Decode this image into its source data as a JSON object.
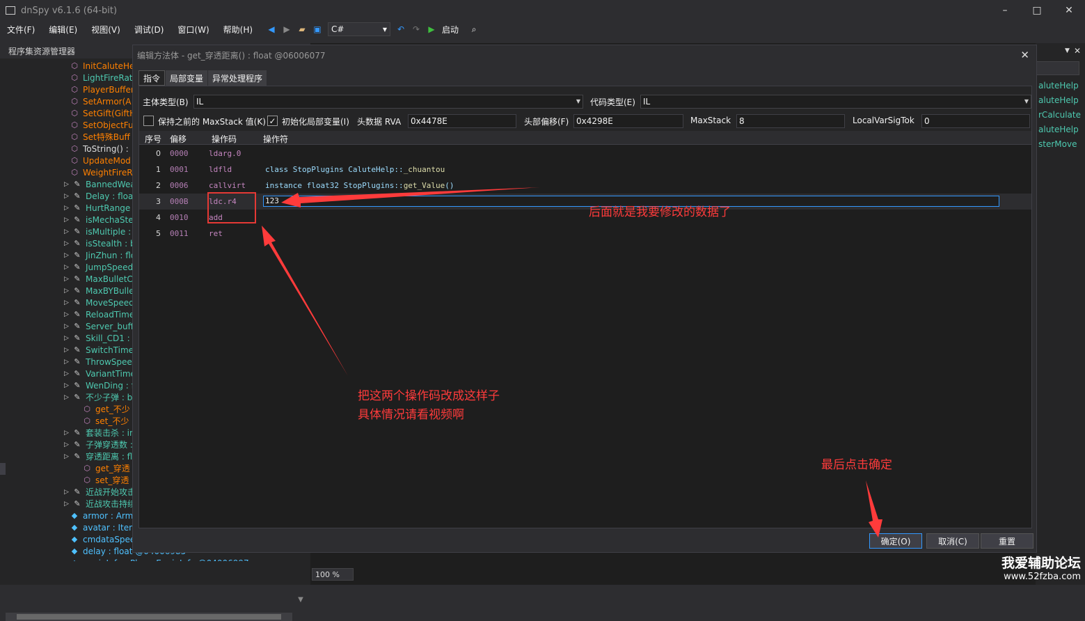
{
  "window": {
    "title": "dnSpy v6.1.6 (64-bit)",
    "minimize": "–",
    "maximize": "□",
    "close": "✕"
  },
  "menu": [
    "文件(F)",
    "编辑(E)",
    "视图(V)",
    "调试(D)",
    "窗口(W)",
    "帮助(H)"
  ],
  "toolbar": {
    "language": "C#",
    "run_label": "启动"
  },
  "left_panel": {
    "title": "程序集资源管理器",
    "items": [
      {
        "text": "InitCaluteHe",
        "color": "orange",
        "icon": "method-icon",
        "expand": false,
        "indent": 0
      },
      {
        "text": "LightFireRat",
        "color": "teal",
        "icon": "method-icon",
        "expand": false,
        "indent": 0
      },
      {
        "text": "PlayerBuffer",
        "color": "orange",
        "icon": "method-icon",
        "expand": false,
        "indent": 0
      },
      {
        "text": "SetArmor(A",
        "color": "orange",
        "icon": "method-icon",
        "expand": false,
        "indent": 0
      },
      {
        "text": "SetGift(GiftH",
        "color": "orange",
        "icon": "method-icon",
        "expand": false,
        "indent": 0
      },
      {
        "text": "SetObjectFu",
        "color": "orange",
        "icon": "method-icon",
        "expand": false,
        "indent": 0
      },
      {
        "text": "Set特殊Buff",
        "color": "orange",
        "icon": "method-icon",
        "expand": false,
        "indent": 0
      },
      {
        "text": "ToString() :",
        "color": "white",
        "icon": "method-icon",
        "expand": false,
        "indent": 0
      },
      {
        "text": "UpdateMod",
        "color": "orange",
        "icon": "method-icon",
        "expand": false,
        "indent": 0
      },
      {
        "text": "WeightFireR",
        "color": "orange",
        "icon": "method-icon",
        "expand": false,
        "indent": 0
      },
      {
        "text": "BannedWea",
        "color": "teal",
        "icon": "wrench-icon",
        "expand": true,
        "indent": -1
      },
      {
        "text": "Delay : float",
        "color": "teal",
        "icon": "wrench-icon",
        "expand": true,
        "indent": -1
      },
      {
        "text": "HurtRange",
        "color": "teal",
        "icon": "wrench-icon",
        "expand": true,
        "indent": -1
      },
      {
        "text": "isMechaSte",
        "color": "teal",
        "icon": "wrench-icon",
        "expand": true,
        "indent": -1
      },
      {
        "text": "isMultiple :",
        "color": "teal",
        "icon": "wrench-icon",
        "expand": true,
        "indent": -1
      },
      {
        "text": "isStealth : b",
        "color": "teal",
        "icon": "wrench-icon",
        "expand": true,
        "indent": -1
      },
      {
        "text": "JinZhun : flo",
        "color": "teal",
        "icon": "wrench-icon",
        "expand": true,
        "indent": -1
      },
      {
        "text": "JumpSpeed",
        "color": "teal",
        "icon": "wrench-icon",
        "expand": true,
        "indent": -1
      },
      {
        "text": "MaxBulletCl",
        "color": "teal",
        "icon": "wrench-icon",
        "expand": true,
        "indent": -1
      },
      {
        "text": "MaxBYBulle",
        "color": "teal",
        "icon": "wrench-icon",
        "expand": true,
        "indent": -1
      },
      {
        "text": "MoveSpeed",
        "color": "teal",
        "icon": "wrench-icon",
        "expand": true,
        "indent": -1
      },
      {
        "text": "ReloadTime",
        "color": "teal",
        "icon": "wrench-icon",
        "expand": true,
        "indent": -1
      },
      {
        "text": "Server_buff",
        "color": "teal",
        "icon": "wrench-icon",
        "expand": true,
        "indent": -1
      },
      {
        "text": "Skill_CD1 : f",
        "color": "teal",
        "icon": "wrench-icon",
        "expand": true,
        "indent": -1
      },
      {
        "text": "SwitchTime",
        "color": "teal",
        "icon": "wrench-icon",
        "expand": true,
        "indent": -1
      },
      {
        "text": "ThrowSpeed",
        "color": "teal",
        "icon": "wrench-icon",
        "expand": true,
        "indent": -1
      },
      {
        "text": "VariantTime",
        "color": "teal",
        "icon": "wrench-icon",
        "expand": true,
        "indent": -1
      },
      {
        "text": "WenDing : f",
        "color": "teal",
        "icon": "wrench-icon",
        "expand": true,
        "indent": -1
      },
      {
        "text": "不少子弹 : b",
        "color": "teal",
        "icon": "wrench-icon",
        "expand": true,
        "indent": -1
      },
      {
        "text": "get_不少",
        "color": "orange",
        "icon": "method-icon",
        "expand": false,
        "indent": 1
      },
      {
        "text": "set_不少",
        "color": "orange",
        "icon": "method-icon",
        "expand": false,
        "indent": 1
      },
      {
        "text": "套装击杀 : in",
        "color": "teal",
        "icon": "wrench-icon",
        "expand": true,
        "indent": -1
      },
      {
        "text": "子弹穿透数 :",
        "color": "teal",
        "icon": "wrench-icon",
        "expand": true,
        "indent": -1
      },
      {
        "text": "穿透距离 : fl",
        "color": "teal",
        "icon": "wrench-icon",
        "expand": true,
        "indent": -1
      },
      {
        "text": "get_穿透",
        "color": "orange",
        "icon": "method-icon",
        "expand": false,
        "indent": 1
      },
      {
        "text": "set_穿透",
        "color": "orange",
        "icon": "method-icon",
        "expand": false,
        "indent": 1
      },
      {
        "text": "近战开始攻击",
        "color": "teal",
        "icon": "wrench-icon",
        "expand": true,
        "indent": -1
      },
      {
        "text": "近战攻击持续",
        "color": "teal",
        "icon": "wrench-icon",
        "expand": true,
        "indent": -1
      },
      {
        "text": "armor : Arm",
        "color": "blue",
        "icon": "field-icon",
        "expand": false,
        "indent": 0
      },
      {
        "text": "avatar : Iten",
        "color": "blue",
        "icon": "field-icon",
        "expand": false,
        "indent": 0
      },
      {
        "text": "cmdataSpee",
        "color": "blue",
        "icon": "field-icon",
        "expand": false,
        "indent": 0
      },
      {
        "text": "delay : float @04006985",
        "color": "blue",
        "icon": "field-icon",
        "expand": false,
        "indent": 0
      },
      {
        "text": "equipInfo : PlayerEquipInfo @04006997",
        "color": "blue",
        "icon": "field-icon",
        "expand": false,
        "indent": 0
      }
    ]
  },
  "right_fragment": {
    "items": [
      "aluteHelp",
      "aluteHelp",
      "rCalculate",
      "aluteHelp",
      "sterMove"
    ]
  },
  "zoom": "100 %",
  "dialog": {
    "title": "编辑方法体 - get_穿透距离() : float @06006077",
    "tabs": [
      "指令",
      "局部变量",
      "异常处理程序"
    ],
    "body_type_label": "主体类型(B)",
    "body_type_value": "IL",
    "code_type_label": "代码类型(E)",
    "code_type_value": "IL",
    "keep_maxstack_label": "保持之前的 MaxStack 值(K)",
    "keep_maxstack_checked": false,
    "init_locals_label": "初始化局部变量(I)",
    "init_locals_checked": true,
    "rva_label": "头数据 RVA",
    "rva_value": "0x4478E",
    "offset_label": "头部偏移(F)",
    "offset_value": "0x4298E",
    "maxstack_label": "MaxStack",
    "maxstack_value": "8",
    "localvarsig_label": "LocalVarSigTok",
    "localvarsig_value": "0",
    "columns": [
      "序号",
      "偏移",
      "操作码",
      "操作符"
    ],
    "rows": [
      {
        "idx": "0",
        "off": "0000",
        "op": "ldarg.0",
        "opr_a": "",
        "opr_b": "",
        "opr_c": ""
      },
      {
        "idx": "1",
        "off": "0001",
        "op": "ldfld",
        "opr_a": "class StopPlugins CaluteHelp::",
        "opr_b": "_chuantou",
        "opr_c": ""
      },
      {
        "idx": "2",
        "off": "0006",
        "op": "callvirt",
        "opr_a": "instance float32 StopPlugins::",
        "opr_b": "get_Value",
        "opr_c": "()"
      },
      {
        "idx": "3",
        "off": "000B",
        "op": "ldc.r4",
        "opr_a": "",
        "opr_b": "",
        "opr_c": ""
      },
      {
        "idx": "4",
        "off": "0010",
        "op": "add",
        "opr_a": "",
        "opr_b": "",
        "opr_c": ""
      },
      {
        "idx": "5",
        "off": "0011",
        "op": "ret",
        "opr_a": "",
        "opr_b": "",
        "opr_c": ""
      }
    ],
    "edit_value": "123",
    "ok_label": "确定(O)",
    "cancel_label": "取消(C)",
    "reset_label": "重置"
  },
  "annotations": {
    "a1": "后面就是我要修改的数据了",
    "a2_line1": "把这两个操作码改成这样子",
    "a2_line2": "具体情况请看视频啊",
    "a3": "最后点击确定"
  },
  "watermark": {
    "line1": "我爱辅助论坛",
    "line2": "www.52fzba.com"
  },
  "colors": {
    "orange": "#ff8000",
    "teal": "#4ec9b0",
    "blue": "#4fc1ff",
    "annotation_red": "#ff3b3b",
    "selection": "#3399ff"
  }
}
